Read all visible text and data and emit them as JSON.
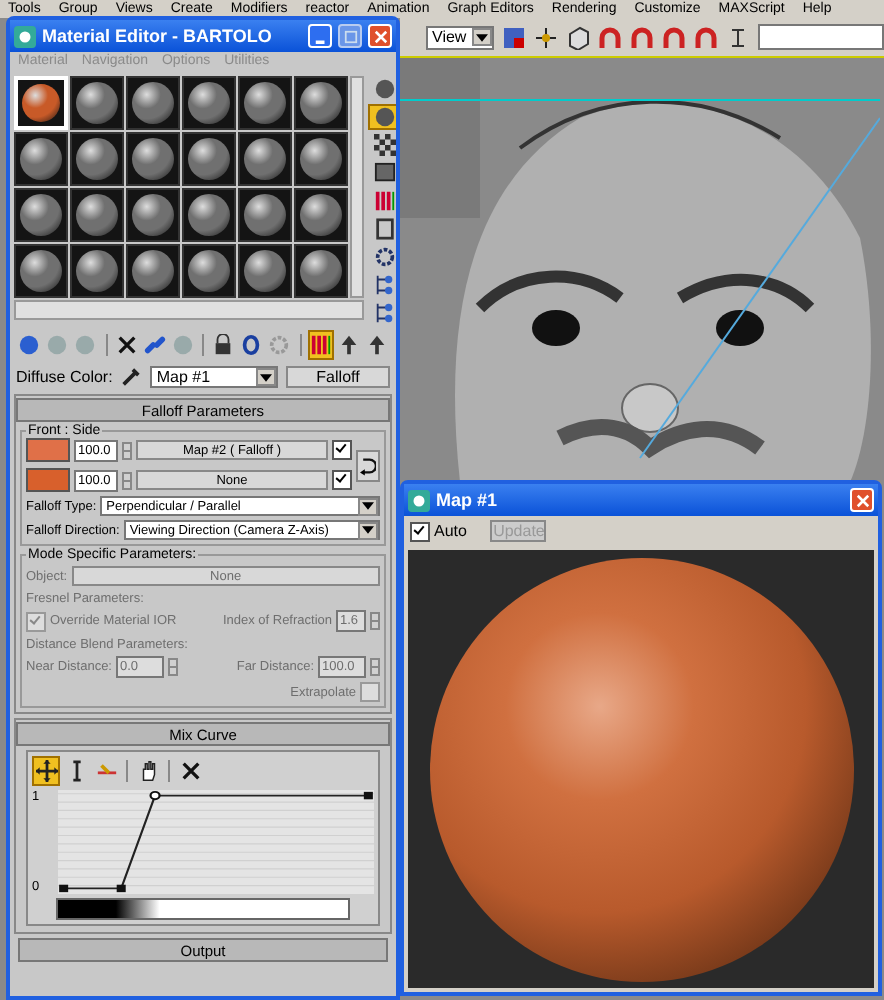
{
  "menu_bar": [
    "Tools",
    "Group",
    "Views",
    "Create",
    "Modifiers",
    "reactor",
    "Animation",
    "Graph Editors",
    "Rendering",
    "Customize",
    "MAXScript",
    "Help"
  ],
  "main_toolbar": {
    "view_dropdown": "View"
  },
  "material_editor": {
    "title": "Material Editor - BARTOLO",
    "menu": [
      {
        "label": "Material",
        "disabled": true
      },
      {
        "label": "Navigation",
        "disabled": true
      },
      {
        "label": "Options",
        "disabled": true
      },
      {
        "label": "Utilities",
        "disabled": true
      }
    ],
    "sample_slots": [
      {
        "selected": true,
        "color": "#c85a28"
      },
      {
        "selected": false,
        "color": "#707070"
      },
      {
        "selected": false,
        "color": "#707070"
      },
      {
        "selected": false,
        "color": "#707070"
      },
      {
        "selected": false,
        "color": "#707070"
      },
      {
        "selected": false,
        "color": "#707070"
      },
      {
        "selected": false,
        "color": "#707070"
      },
      {
        "selected": false,
        "color": "#707070"
      },
      {
        "selected": false,
        "color": "#707070"
      },
      {
        "selected": false,
        "color": "#707070"
      },
      {
        "selected": false,
        "color": "#707070"
      },
      {
        "selected": false,
        "color": "#707070"
      },
      {
        "selected": false,
        "color": "#707070"
      },
      {
        "selected": false,
        "color": "#707070"
      },
      {
        "selected": false,
        "color": "#707070"
      },
      {
        "selected": false,
        "color": "#707070"
      },
      {
        "selected": false,
        "color": "#707070"
      },
      {
        "selected": false,
        "color": "#707070"
      },
      {
        "selected": false,
        "color": "#707070"
      },
      {
        "selected": false,
        "color": "#707070"
      },
      {
        "selected": false,
        "color": "#707070"
      },
      {
        "selected": false,
        "color": "#707070"
      },
      {
        "selected": false,
        "color": "#707070"
      },
      {
        "selected": false,
        "color": "#707070"
      }
    ],
    "side_toolbar": [
      {
        "on": false
      },
      {
        "on": true
      },
      {
        "on": false
      },
      {
        "on": false
      },
      {
        "on": false
      },
      {
        "on": false
      },
      {
        "on": false
      },
      {
        "on": false
      },
      {
        "on": false
      }
    ],
    "toolbar": [
      {
        "on": false
      },
      {
        "on": false
      },
      {
        "on": false
      },
      {
        "on": false
      },
      {
        "on": false
      },
      {
        "on": false
      },
      {
        "on": false
      },
      {
        "on": false
      },
      {
        "on": false
      },
      {
        "on": true
      },
      {
        "on": false
      },
      {
        "on": false
      }
    ],
    "diffuse_label": "Diffuse Color:",
    "map_name": "Map #1",
    "map_type": "Falloff",
    "falloff_parameters": {
      "title": "Falloff Parameters",
      "group_title": "Front : Side",
      "rows": [
        {
          "color": "#e07048",
          "amount": "100.0",
          "map": "Map #2  ( Falloff )",
          "enabled": true
        },
        {
          "color": "#d8602c",
          "amount": "100.0",
          "map": "None",
          "enabled": true
        }
      ],
      "falloff_type_label": "Falloff Type:",
      "falloff_type": "Perpendicular / Parallel",
      "falloff_direction_label": "Falloff Direction:",
      "falloff_direction": "Viewing Direction (Camera Z-Axis)"
    },
    "mode_specific": {
      "title": "Mode Specific Parameters:",
      "disabled": true,
      "object_label": "Object:",
      "object_value": "None",
      "fresnel_title": "Fresnel Parameters:",
      "override_ior": {
        "label": "Override Material IOR",
        "checked": true
      },
      "ior_label": "Index of Refraction",
      "ior_value": "1.6",
      "distance_title": "Distance Blend Parameters:",
      "near_label": "Near Distance:",
      "near_value": "0.0",
      "far_label": "Far Distance:",
      "far_value": "100.0",
      "extrapolate": {
        "label": "Extrapolate",
        "checked": false
      }
    },
    "mix_curve": {
      "title": "Mix Curve",
      "tools": [
        {
          "on": true
        },
        {
          "on": false
        },
        {
          "on": false
        },
        {
          "on": false
        },
        {
          "on": false
        }
      ],
      "y_max": "1",
      "y_min": "0"
    },
    "output_title": "Output"
  },
  "map_window": {
    "title": "Map #1",
    "auto": {
      "label": "Auto",
      "checked": true
    },
    "update_button": {
      "label": "Update",
      "disabled": true
    }
  }
}
